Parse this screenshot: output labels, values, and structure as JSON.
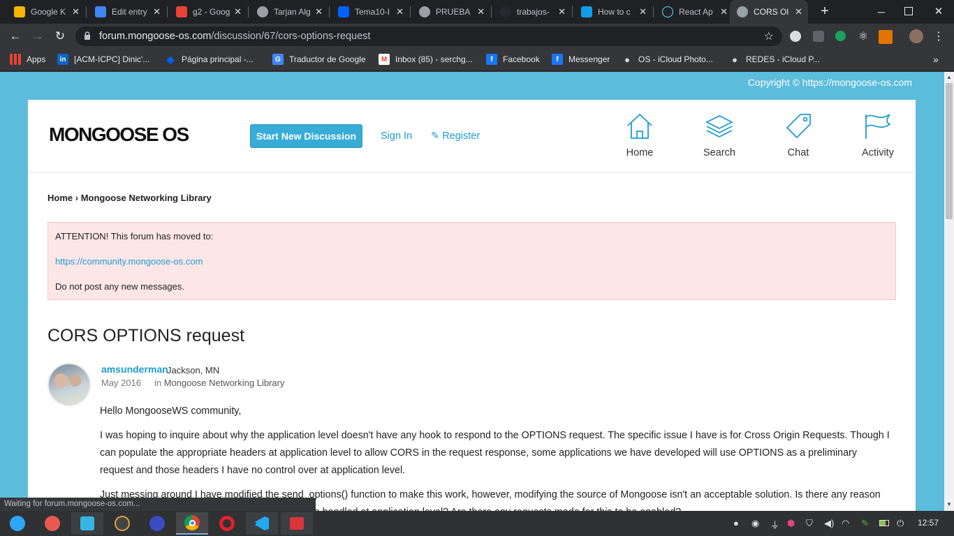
{
  "tabs": [
    {
      "label": "Google K",
      "color": "#f4b400"
    },
    {
      "label": "Edit entry",
      "color": "#4285f4"
    },
    {
      "label": "g2 - Goog",
      "color": "#ea4335"
    },
    {
      "label": "Tarjan Alg",
      "color": "#9aa0a6"
    },
    {
      "label": "Tema10-I",
      "color": "#0061fe"
    },
    {
      "label": "PRUEBA",
      "color": "#9aa0a6"
    },
    {
      "label": "trabajos-",
      "color": "#24292e"
    },
    {
      "label": "How to c",
      "color": "#0f9ee9"
    },
    {
      "label": "React Ap",
      "color": "#61dafb"
    },
    {
      "label": "CORS Ol",
      "color": "#9aa0a6"
    }
  ],
  "address": {
    "domain": "forum.mongoose-os.com",
    "path": "/discussion/67/cors-options-request"
  },
  "bookmarks": [
    {
      "label": "Apps",
      "icon": "apps-grid-icon",
      "color": "#ea4335"
    },
    {
      "label": "[ACM-ICPC] Dinic'...",
      "icon": "linkedin-icon",
      "color": "#0a66c2",
      "glyph": "in"
    },
    {
      "label": "Página principal -...",
      "icon": "dropbox-icon",
      "color": "#0061fe",
      "glyph": "◆"
    },
    {
      "label": "Traductor de Google",
      "icon": "translate-icon",
      "color": "#4285f4",
      "glyph": "G"
    },
    {
      "label": "Inbox (85) - serchg...",
      "icon": "gmail-icon",
      "color": "#ea4335",
      "glyph": "M"
    },
    {
      "label": "Facebook",
      "icon": "facebook-icon",
      "color": "#1877f2",
      "glyph": "f"
    },
    {
      "label": "Messenger",
      "icon": "facebook-icon",
      "color": "#1877f2",
      "glyph": "f"
    },
    {
      "label": "OS - iCloud Photo...",
      "icon": "apple-icon",
      "color": "#35363a",
      "glyph": "●"
    },
    {
      "label": "REDES - iCloud P...",
      "icon": "apple-icon",
      "color": "#35363a",
      "glyph": "●"
    }
  ],
  "page": {
    "copyright": "Copyright © https://mongoose-os.com",
    "logo": "MONGOOSE OS",
    "new_discussion": "Start New Discussion",
    "sign_in": "Sign In",
    "register": "Register",
    "nav": [
      {
        "label": "Home",
        "icon": "home-icon"
      },
      {
        "label": "Search",
        "icon": "layers-icon"
      },
      {
        "label": "Chat",
        "icon": "tag-icon"
      },
      {
        "label": "Activity",
        "icon": "flag-icon"
      }
    ],
    "breadcrumb": {
      "home": "Home",
      "sep": "›",
      "category": "Mongoose Networking Library"
    },
    "alert": {
      "line1": "ATTENTION! This forum has moved to:",
      "link": "https://community.mongoose-os.com",
      "line3": "Do not post any new messages."
    },
    "title": "CORS OPTIONS request",
    "post": {
      "author": "amsunderman",
      "location": "Jackson, MN",
      "date": "May 2016",
      "in": "in",
      "category": "Mongoose Networking Library",
      "p1": "Hello MongooseWS community,",
      "p2": "I was hoping to inquire about why the application level doesn't have any hook to respond to the OPTIONS request. The specific issue I have is for Cross Origin Requests. Though I can populate the appropriate headers at application level to allow CORS in the request response, some applications we have developed will use OPTIONS as a preliminary request and those headers I have no control over at application level.",
      "p3": "Just messing around I have modified the send_options() function to make this work, however, modifying the source of Mongoose isn't an acceptable solution. Is there any reason why the OPTIONS response is not available to be handled at application level? Are there any requests made for this to be enabled?"
    }
  },
  "status": "Waiting for forum.mongoose-os.com...",
  "clock": "12:57"
}
